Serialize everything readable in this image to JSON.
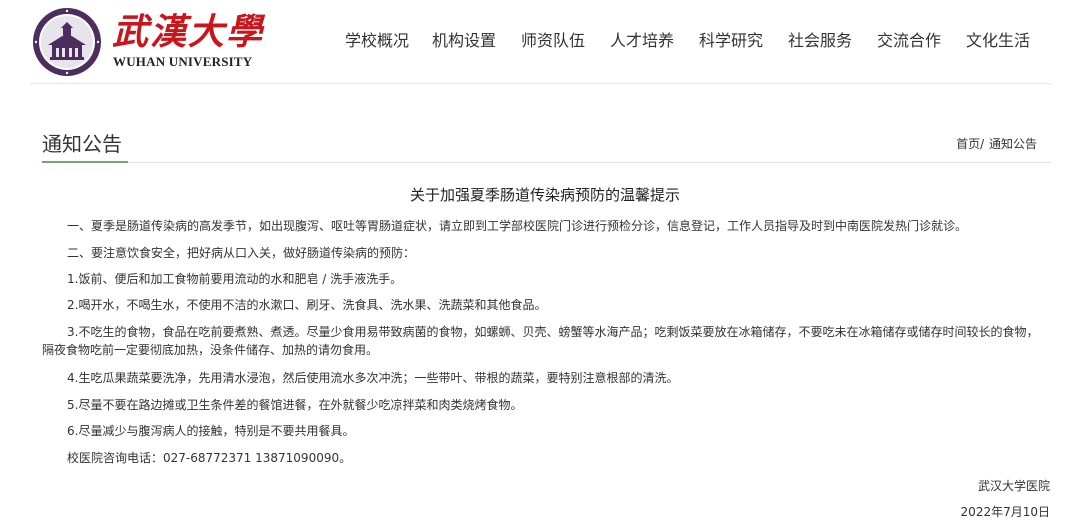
{
  "header": {
    "logo_cn": "武漢大學",
    "logo_en": "WUHAN UNIVERSITY",
    "nav": [
      "学校概况",
      "机构设置",
      "师资队伍",
      "人才培养",
      "科学研究",
      "社会服务",
      "交流合作",
      "文化生活"
    ]
  },
  "section": {
    "title": "通知公告",
    "breadcrumb": {
      "home": "首页",
      "separator": "/",
      "current": "通知公告"
    }
  },
  "article": {
    "title": "关于加强夏季肠道传染病预防的温馨提示",
    "paragraphs": [
      "一、夏季是肠道传染病的高发季节，如出现腹泻、呕吐等胃肠道症状，请立即到工学部校医院门诊进行预检分诊，信息登记，工作人员指导及时到中南医院发热门诊就诊。",
      "二、要注意饮食安全，把好病从口入关，做好肠道传染病的预防：",
      "1.饭前、便后和加工食物前要用流动的水和肥皂 / 洗手液洗手。",
      "2.喝开水，不喝生水，不使用不洁的水漱口、刷牙、洗食具、洗水果、洗蔬菜和其他食品。",
      "3.不吃生的食物，食品在吃前要煮熟、煮透。尽量少食用易带致病菌的食物，如螺蛳、贝壳、螃蟹等水海产品；吃剩饭菜要放在冰箱储存，不要吃未在冰箱储存或储存时间较长的食物，隔夜食物吃前一定要彻底加热，没条件储存、加热的请勿食用。",
      "4.生吃瓜果蔬菜要洗净，先用清水浸泡，然后使用流水多次冲洗；一些带叶、带根的蔬菜，要特别注意根部的清洗。",
      "5.尽量不要在路边摊或卫生条件差的餐馆进餐，在外就餐少吃凉拌菜和肉类烧烤食物。",
      "6.尽量减少与腹泻病人的接触，特别是不要共用餐具。",
      "校医院咨询电话：027-68772371 13871090090。"
    ],
    "signature": "武汉大学医院",
    "date": "2022年7月10日"
  },
  "colors": {
    "brand_red": "#c8161d",
    "emblem_purple": "#4b2e5e",
    "title_underline": "#7aa07a"
  }
}
